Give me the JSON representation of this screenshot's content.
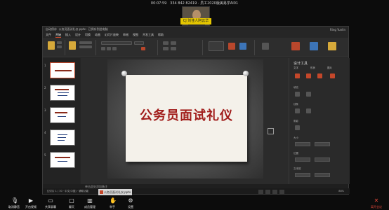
{
  "meeting": {
    "timer": "00:07:59",
    "info": "334 842 82419 · 员工2020版美易学AI01",
    "participant_label": "CJ 刘佳人阿云华"
  },
  "ppt": {
    "title_left": "自动保存",
    "file_title": "公务员面试礼仪.pptx · 已保存到此电脑",
    "user": "Ring Yunlin",
    "menu": [
      "文件",
      "开始",
      "插入",
      "设计",
      "切换",
      "动画",
      "幻灯片放映",
      "审阅",
      "视图",
      "开发工具",
      "帮助"
    ],
    "active_menu": "开始",
    "slide_title": "公务员面试礼仪",
    "thumb_numbers": [
      "1",
      "2",
      "3",
      "4",
      "5"
    ],
    "notes_placeholder": "单击此处添加备注",
    "status_text": "幻灯片 1 / 30 · 中文(中国) · 辅助功能",
    "zoom": "88%"
  },
  "panel": {
    "title": "设计工具",
    "tabs": [
      "文字",
      "形状",
      "图片"
    ],
    "rows": [
      "填充",
      "线条",
      "阴影",
      "大小",
      "位置",
      "文本框"
    ]
  },
  "taskbar": {
    "task_label": "公务员面试礼仪.pptx"
  },
  "bottom": {
    "buttons": [
      "取消静音",
      "开启视频",
      "共享屏幕",
      "聊天",
      "成员管理",
      "举手",
      "设置"
    ],
    "leave": "离开会议"
  },
  "colors": {
    "accent": "#c4472a",
    "title_red": "#a11d1b",
    "leave_red": "#e5483a"
  }
}
